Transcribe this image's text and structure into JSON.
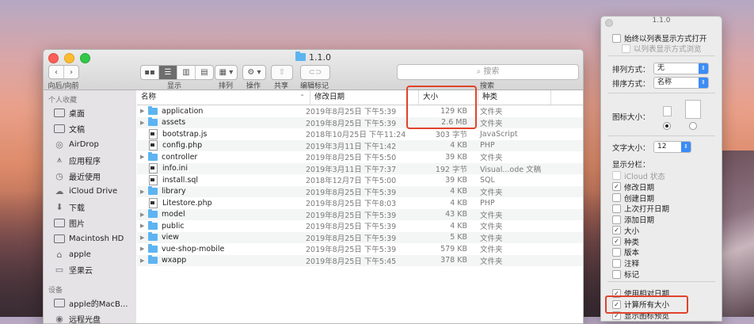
{
  "window": {
    "title": "1.1.0",
    "toolbar": {
      "back_forward_label": "向后/向前",
      "view_label": "显示",
      "arrange_label": "排列",
      "action_label": "操作",
      "share_label": "共享",
      "edit_tags_label": "编辑标记",
      "search_placeholder": "搜索",
      "search_label": "搜索"
    }
  },
  "sidebar": {
    "favorites_header": "个人收藏",
    "favorites": [
      {
        "label": "桌面",
        "icon": "desktop-icon"
      },
      {
        "label": "文稿",
        "icon": "documents-icon"
      },
      {
        "label": "AirDrop",
        "icon": "airdrop-icon"
      },
      {
        "label": "应用程序",
        "icon": "applications-icon"
      },
      {
        "label": "最近使用",
        "icon": "recents-icon"
      },
      {
        "label": "iCloud Drive",
        "icon": "icloud-icon"
      },
      {
        "label": "下载",
        "icon": "downloads-icon"
      },
      {
        "label": "图片",
        "icon": "pictures-icon"
      },
      {
        "label": "Macintosh HD",
        "icon": "disk-icon"
      },
      {
        "label": "apple",
        "icon": "home-icon"
      },
      {
        "label": "坚果云",
        "icon": "folder-icon"
      }
    ],
    "devices_header": "设备",
    "devices": [
      {
        "label": "apple的MacB...",
        "icon": "laptop-icon"
      },
      {
        "label": "远程光盘",
        "icon": "disc-icon"
      }
    ]
  },
  "columns": {
    "name": "名称",
    "date": "修改日期",
    "size": "大小",
    "kind": "种类"
  },
  "files": [
    {
      "name": "application",
      "type": "folder",
      "date": "2019年8月25日 下午5:39",
      "size": "129 KB",
      "kind": "文件夹"
    },
    {
      "name": "assets",
      "type": "folder",
      "date": "2019年8月25日 下午5:39",
      "size": "2.6 MB",
      "kind": "文件夹"
    },
    {
      "name": "bootstrap.js",
      "type": "file",
      "date": "2018年10月25日 下午11:24",
      "size": "303 字节",
      "kind": "JavaScript"
    },
    {
      "name": "config.php",
      "type": "file",
      "date": "2019年3月11日 下午1:42",
      "size": "4 KB",
      "kind": "PHP"
    },
    {
      "name": "controller",
      "type": "folder",
      "date": "2019年8月25日 下午5:50",
      "size": "39 KB",
      "kind": "文件夹"
    },
    {
      "name": "info.ini",
      "type": "file",
      "date": "2019年3月11日 下午7:37",
      "size": "192 字节",
      "kind": "Visual...ode 文稿"
    },
    {
      "name": "install.sql",
      "type": "file",
      "date": "2018年12月7日 下午5:00",
      "size": "39 KB",
      "kind": "SQL"
    },
    {
      "name": "library",
      "type": "folder",
      "date": "2019年8月25日 下午5:39",
      "size": "4 KB",
      "kind": "文件夹"
    },
    {
      "name": "Litestore.php",
      "type": "file",
      "date": "2019年8月25日 下午8:03",
      "size": "4 KB",
      "kind": "PHP"
    },
    {
      "name": "model",
      "type": "folder",
      "date": "2019年8月25日 下午5:39",
      "size": "43 KB",
      "kind": "文件夹"
    },
    {
      "name": "public",
      "type": "folder",
      "date": "2019年8月25日 下午5:39",
      "size": "4 KB",
      "kind": "文件夹"
    },
    {
      "name": "view",
      "type": "folder",
      "date": "2019年8月25日 下午5:39",
      "size": "5 KB",
      "kind": "文件夹"
    },
    {
      "name": "vue-shop-mobile",
      "type": "folder",
      "date": "2019年8月25日 下午5:39",
      "size": "579 KB",
      "kind": "文件夹"
    },
    {
      "name": "wxapp",
      "type": "folder",
      "date": "2019年8月25日 下午5:45",
      "size": "378 KB",
      "kind": "文件夹"
    }
  ],
  "view_options": {
    "title": "1.1.0",
    "always_open_list": "始终以列表显示方式打开",
    "browse_list": "以列表显示方式浏览",
    "arrange_by_label": "排列方式：",
    "arrange_by_value": "无",
    "sort_by_label": "排序方式：",
    "sort_by_value": "名称",
    "icon_size_label": "图标大小：",
    "text_size_label": "文字大小：",
    "text_size_value": "12",
    "show_columns_label": "显示分栏：",
    "columns": [
      {
        "label": "iCloud 状态",
        "checked": false,
        "disabled": true
      },
      {
        "label": "修改日期",
        "checked": true
      },
      {
        "label": "创建日期",
        "checked": false
      },
      {
        "label": "上次打开日期",
        "checked": false
      },
      {
        "label": "添加日期",
        "checked": false
      },
      {
        "label": "大小",
        "checked": true
      },
      {
        "label": "种类",
        "checked": true
      },
      {
        "label": "版本",
        "checked": false
      },
      {
        "label": "注释",
        "checked": false
      },
      {
        "label": "标记",
        "checked": false
      }
    ],
    "use_relative_dates": "使用相对日期",
    "calculate_all_sizes": "计算所有大小",
    "show_icon_preview": "显示图标预览"
  },
  "colors": {
    "highlight": "#e0432c",
    "folder": "#5db4f1",
    "accent": "#3c8cf7"
  }
}
